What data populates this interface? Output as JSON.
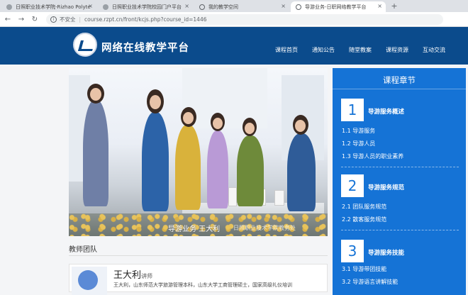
{
  "browser": {
    "tabs": [
      {
        "label": "日照职业技术学院-Rizhao Polyte",
        "active": false
      },
      {
        "label": "日照职业技术学院校园门户平台",
        "active": false
      },
      {
        "label": "我的教学空间",
        "active": false
      },
      {
        "label": "导游业务-日职网络教学平台",
        "active": true
      }
    ],
    "new_tab": "+",
    "insecure_label": "不安全",
    "url": "course.rzpt.cn/front/kcjs.php?course_id=1446"
  },
  "site": {
    "title": "网络在线教学平台",
    "nav": [
      "课程首页",
      "通知公告",
      "随堂教案",
      "课程资源",
      "互动交流"
    ]
  },
  "hero": {
    "caption": "导游业务 王大利",
    "watermark": "日照职业技术学院教务处"
  },
  "team": {
    "heading": "教师团队",
    "teacher": {
      "name": "王大利",
      "title": "讲师",
      "desc": "王大利，山东师范大学旅游管理本科，山东大学工商管理硕士，国家高级礼仪培训"
    }
  },
  "chapters": {
    "title": "课程章节",
    "list": [
      {
        "num": "1",
        "name": "导游服务概述",
        "items": [
          "1.1 导游服务",
          "1.2 导游人员",
          "1.3 导游人员的职业素养"
        ]
      },
      {
        "num": "2",
        "name": "导游服务规范",
        "items": [
          "2.1 团队服务规范",
          "2.2 散客服务规范"
        ]
      },
      {
        "num": "3",
        "name": "导游服务技能",
        "items": [
          "3.1 导游带团技能",
          "3.2 导游语言讲解技能"
        ]
      }
    ]
  },
  "colors": {
    "header": "#0b4b8c",
    "panel": "#1573d6"
  }
}
